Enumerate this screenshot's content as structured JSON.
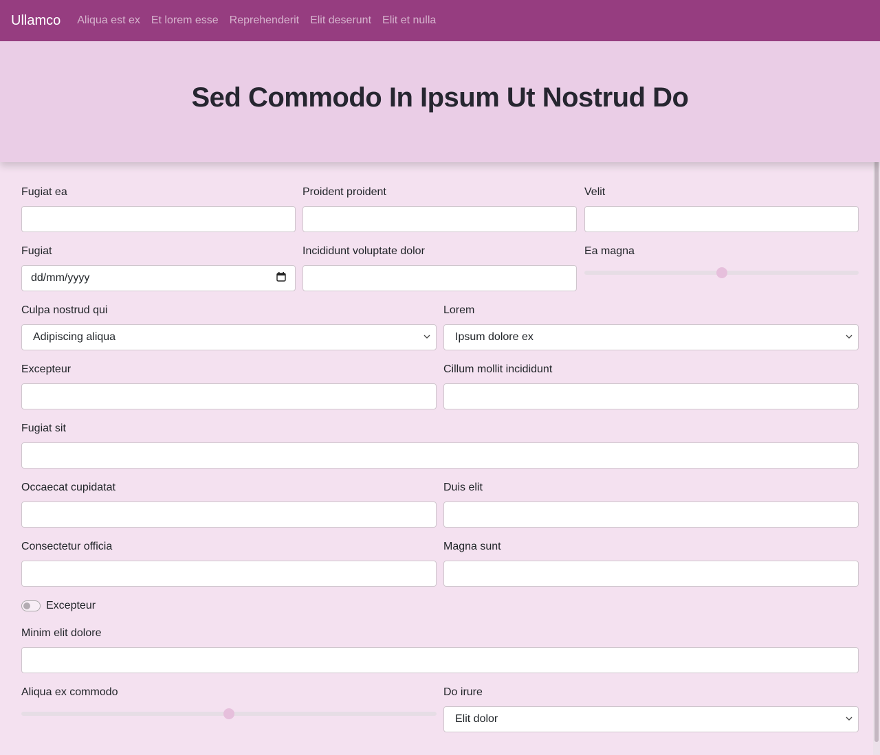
{
  "navbar": {
    "brand": "Ullamco",
    "links": [
      "Aliqua est ex",
      "Et lorem esse",
      "Reprehenderit",
      "Elit deserunt",
      "Elit et nulla"
    ]
  },
  "hero": {
    "title": "Sed Commodo In Ipsum Ut Nostrud Do"
  },
  "form": {
    "fugiat_ea": {
      "label": "Fugiat ea",
      "value": ""
    },
    "proident_proident": {
      "label": "Proident proident",
      "value": ""
    },
    "velit": {
      "label": "Velit",
      "value": ""
    },
    "fugiat": {
      "label": "Fugiat",
      "placeholder": "dd/mm/yyyy"
    },
    "incididunt_voluptate_dolor": {
      "label": "Incididunt voluptate dolor",
      "value": ""
    },
    "ea_magna": {
      "label": "Ea magna",
      "value_percent": 50
    },
    "culpa_nostrud_qui": {
      "label": "Culpa nostrud qui",
      "selected": "Adipiscing aliqua"
    },
    "lorem": {
      "label": "Lorem",
      "selected": "Ipsum dolore ex"
    },
    "excepteur": {
      "label": "Excepteur",
      "value": ""
    },
    "cillum_mollit_incididunt": {
      "label": "Cillum mollit incididunt",
      "value": ""
    },
    "fugiat_sit": {
      "label": "Fugiat sit",
      "value": ""
    },
    "occaecat_cupidatat": {
      "label": "Occaecat cupidatat",
      "value": ""
    },
    "duis_elit": {
      "label": "Duis elit",
      "value": ""
    },
    "consectetur_officia": {
      "label": "Consectetur officia",
      "value": ""
    },
    "magna_sunt": {
      "label": "Magna sunt",
      "value": ""
    },
    "excepteur_switch": {
      "label": "Excepteur",
      "checked": false
    },
    "minim_elit_dolore": {
      "label": "Minim elit dolore",
      "value": ""
    },
    "aliqua_ex_commodo": {
      "label": "Aliqua ex commodo",
      "value_percent": 50
    },
    "do_irure": {
      "label": "Do irure",
      "selected": "Elit dolor"
    }
  },
  "icons": {
    "calendar": "calendar-icon",
    "chevron": "chevron-down-icon"
  },
  "colors": {
    "navbar": "#963d80",
    "hero": "#eacde6",
    "background": "#f4e1f0"
  }
}
